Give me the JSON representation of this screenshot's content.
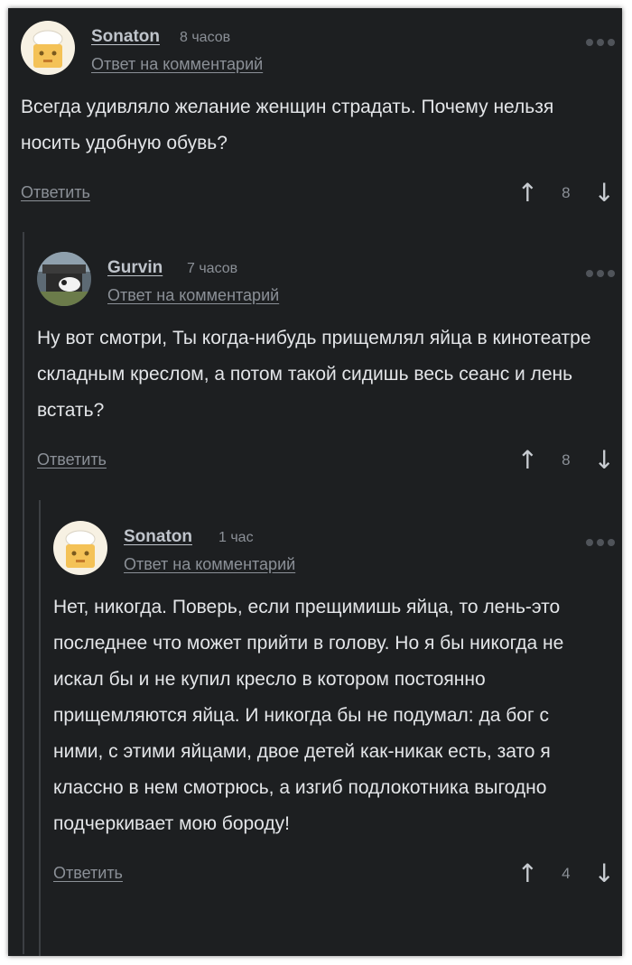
{
  "comments": [
    {
      "username": "Sonaton",
      "time": "8 часов",
      "reply_link": "Ответ на комментарий",
      "text": "Всегда удивляло желание женщин страдать. Почему нельзя носить удобную обувь?",
      "reply_button": "Ответить",
      "score": "8"
    },
    {
      "username": "Gurvin",
      "time": "7 часов",
      "reply_link": "Ответ на комментарий",
      "text": "Ну вот смотри, Ты когда-нибудь прищемлял яйца в кинотеатре складным креслом, а потом такой сидишь весь сеанс и лень встать?",
      "reply_button": "Ответить",
      "score": "8"
    },
    {
      "username": "Sonaton",
      "time": "1 час",
      "reply_link": "Ответ на комментарий",
      "text": "Нет, никогда. Поверь, если прещимишь яйца, то лень-это последнее что может прийти в голову. Но я бы никогда не искал бы и не купил кресло в котором постоянно прищемляются яйца. И никогда бы не подумал: да бог с ними, с этими яйцами, двое детей как-никак есть, зато я классно в нем смотрюсь, а изгиб подлокотника выгодно подчеркивает мою бороду!",
      "reply_button": "Ответить",
      "score": "4"
    }
  ],
  "icons": {
    "upvote": "arrow-up-icon",
    "downvote": "arrow-down-icon",
    "more": "more-dots-icon"
  },
  "colors": {
    "background": "#1d1f21",
    "text": "#e3e5e8",
    "muted": "#8b9097",
    "avatar_yellow": "#f4c257"
  }
}
